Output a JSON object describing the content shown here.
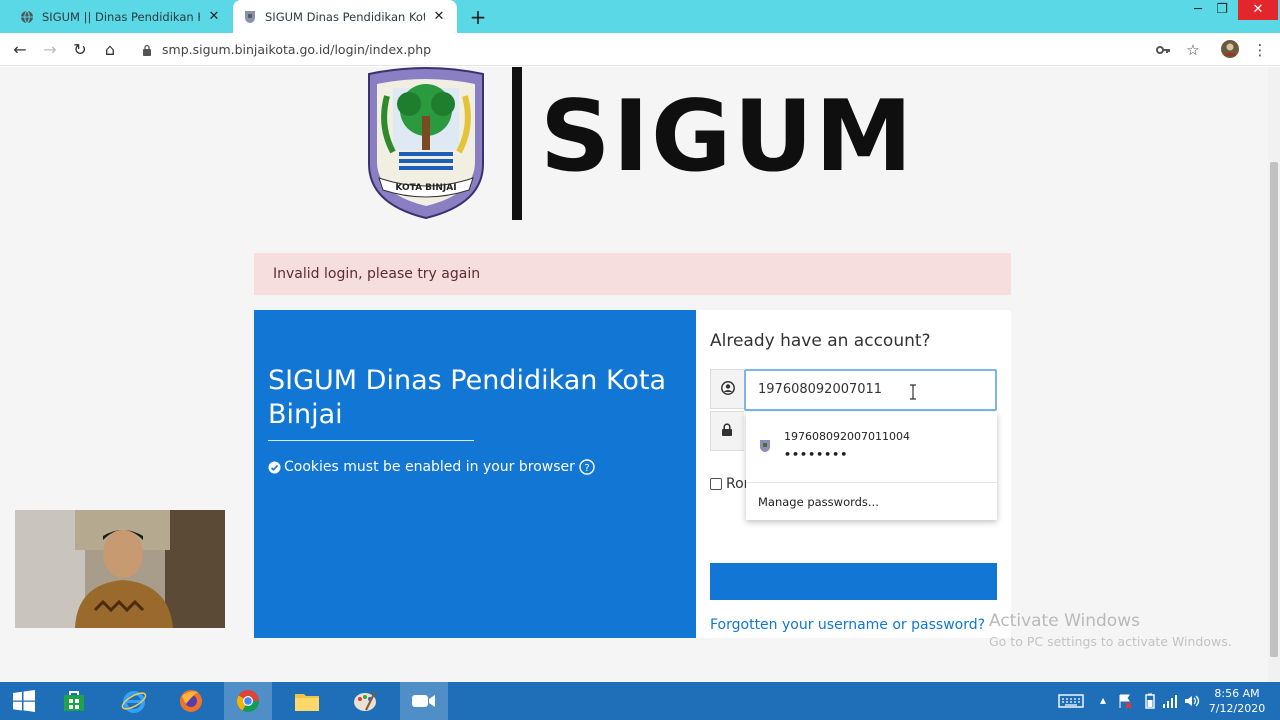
{
  "browser": {
    "tabs": [
      {
        "title": "SIGUM || Dinas Pendidikan Kota Binjai",
        "active": false
      },
      {
        "title": "SIGUM Dinas Pendidikan Kota Binjai",
        "active": true
      }
    ],
    "new_tab_label": "+",
    "url": "smp.sigum.binjaikota.go.id/login/index.php",
    "window_controls": {
      "minimize": "─",
      "restore": "❐",
      "close": "✕"
    }
  },
  "header": {
    "logo_text": "SIGUM",
    "emblem_caption": "KOTA BINJAI"
  },
  "alert": {
    "message": "Invalid login, please try again"
  },
  "left_panel": {
    "title": "SIGUM Dinas Pendidikan Kota Binjai",
    "cookies_notice": "Cookies must be enabled in your browser"
  },
  "login": {
    "heading": "Already have an account?",
    "username_value": "197608092007011",
    "remember_label": "Ror",
    "forgot_link": "Forgotten your username or password?"
  },
  "autofill": {
    "saved_username": "197608092007011004",
    "saved_password_mask": "••••••••",
    "manage_label": "Manage passwords..."
  },
  "watermark": {
    "title": "Activate Windows",
    "subtitle": "Go to PC settings to activate Windows."
  },
  "taskbar": {
    "time": "8:56 AM",
    "date": "7/12/2020"
  },
  "colors": {
    "brand_blue": "#1176d4",
    "alert_bg": "#f6dede",
    "tab_strip": "#5ad8e6",
    "taskbar": "#1f6fb8"
  }
}
